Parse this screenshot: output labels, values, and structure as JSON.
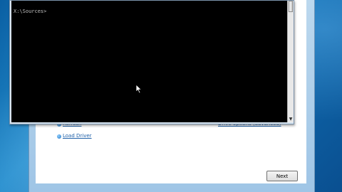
{
  "console": {
    "prompt_line": "X:\\Sources>",
    "scroll_down_arrow": "▼"
  },
  "setup": {
    "links": {
      "drive_options": "Drive options (advanced)",
      "refresh": "Refresh",
      "load_driver": "Load Driver"
    },
    "next_label": "Next"
  },
  "colors": {
    "console_background": "#000000",
    "console_text": "#c0c0c0",
    "desktop_blue": "#1a86c8",
    "link_blue": "#1d5fa8"
  },
  "icons": [
    "refresh-icon",
    "load-driver-icon",
    "mouse-cursor-icon"
  ]
}
